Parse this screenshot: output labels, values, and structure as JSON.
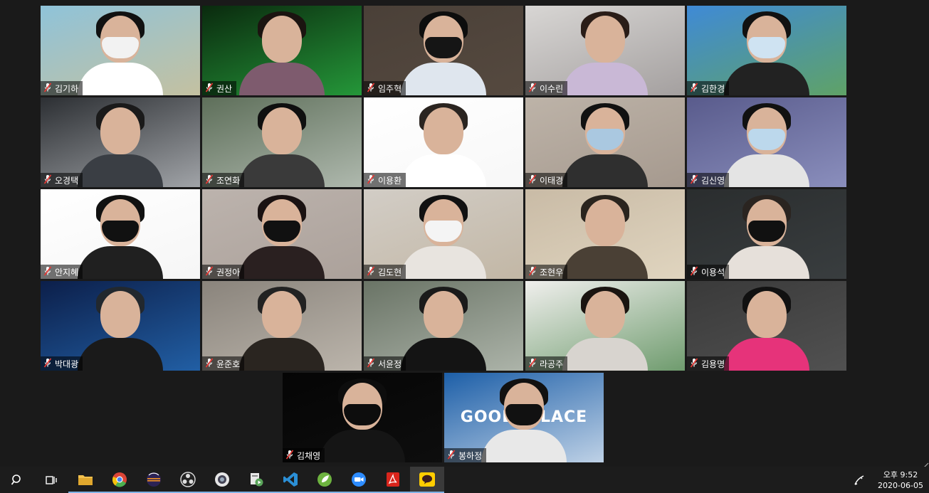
{
  "participants": [
    {
      "name": "김기하",
      "bg": "#8fc3d9",
      "accent": "#d9c08a",
      "shirt": "#ffffff",
      "mask": "#f2f2f2",
      "hair": "#111111"
    },
    {
      "name": "권산",
      "bg": "#0a2a0e",
      "accent": "#2fc24a",
      "shirt": "#7e5b6e",
      "mask": "",
      "hair": "#1b1410"
    },
    {
      "name": "임주혁",
      "bg": "#4a4038",
      "accent": "#5a4d42",
      "shirt": "#dfe6ee",
      "mask": "#151515",
      "hair": "#0d0d0d"
    },
    {
      "name": "이수린",
      "bg": "#d8d6d4",
      "accent": "#8f8a8a",
      "shirt": "#c9b8d6",
      "mask": "",
      "hair": "#2a1d18"
    },
    {
      "name": "김한경",
      "bg": "#3f8ad6",
      "accent": "#6cac3a",
      "shirt": "#222222",
      "mask": "#cfe3f2",
      "hair": "#111111"
    },
    {
      "name": "오경택",
      "bg": "#2c2f33",
      "accent": "#cfd2d6",
      "shirt": "#3a3e44",
      "mask": "",
      "hair": "#1a1a1a"
    },
    {
      "name": "조연화",
      "bg": "#5e6f5a",
      "accent": "#cfd6cf",
      "shirt": "#3a3a3a",
      "mask": "",
      "hair": "#0f0f0f"
    },
    {
      "name": "이용환",
      "bg": "#ffffff",
      "accent": "#f4f4f4",
      "shirt": "#ffffff",
      "mask": "",
      "hair": "#2a2420"
    },
    {
      "name": "이태경",
      "bg": "#bdb3a8",
      "accent": "#9c8f84",
      "shirt": "#2f2f2f",
      "mask": "#aac8e0",
      "hair": "#111111"
    },
    {
      "name": "김신영",
      "bg": "#595b8c",
      "accent": "#9ea3d0",
      "shirt": "#e4e4e4",
      "mask": "#bcd8ec",
      "hair": "#111111"
    },
    {
      "name": "안지혜",
      "bg": "#ffffff",
      "accent": "#f2f2f2",
      "shirt": "#202020",
      "mask": "#111111",
      "hair": "#111111"
    },
    {
      "name": "권정아",
      "bg": "#bcb3ad",
      "accent": "#a59a93",
      "shirt": "#2a2020",
      "mask": "#111111",
      "hair": "#1a1212"
    },
    {
      "name": "김도현",
      "bg": "#d2cdc6",
      "accent": "#bcae98",
      "shirt": "#e8e4df",
      "mask": "#f4f4f4",
      "hair": "#111111"
    },
    {
      "name": "조현우",
      "bg": "#c9bba6",
      "accent": "#e9dfc9",
      "shirt": "#4a4035",
      "mask": "",
      "hair": "#2a241e"
    },
    {
      "name": "이용석",
      "bg": "#2a2d2e",
      "accent": "#3f4446",
      "shirt": "#e6e0da",
      "mask": "#111111",
      "hair": "#2a2420"
    },
    {
      "name": "박대광",
      "bg": "#0c1f4a",
      "accent": "#2a78c8",
      "shirt": "#1a1a1a",
      "mask": "",
      "hair": "#22282e"
    },
    {
      "name": "윤준호",
      "bg": "#8a847c",
      "accent": "#cfc8be",
      "shirt": "#2a2520",
      "mask": "",
      "hair": "#222222"
    },
    {
      "name": "서윤정",
      "bg": "#6a7466",
      "accent": "#c7cdc4",
      "shirt": "#141414",
      "mask": "",
      "hair": "#1a1a1a"
    },
    {
      "name": "라공주",
      "bg": "#f0efed",
      "accent": "#3b7a3b",
      "shirt": "#d8d4cf",
      "mask": "",
      "hair": "#1a1410"
    },
    {
      "name": "김용명",
      "bg": "#3a3a3a",
      "accent": "#5a5a5a",
      "shirt": "#e6337a",
      "mask": "",
      "hair": "#111111"
    },
    {
      "name": "김채영",
      "bg": "#050505",
      "accent": "#111111",
      "shirt": "#151515",
      "mask": "#0d0d0d",
      "hair": "#0d0d0d"
    },
    {
      "name": "봉하정",
      "bg": "#1d5fa8",
      "accent": "#ffffff",
      "shirt": "#e8e8e8",
      "mask": "#111111",
      "hair": "#111111",
      "sign": "GOOD  PLACE"
    }
  ],
  "taskbar": {
    "apps": [
      {
        "icon": "search-icon",
        "color": "#ffffff"
      },
      {
        "icon": "task-view-icon",
        "color": "#ffffff"
      },
      {
        "icon": "file-explorer-icon",
        "color": "#f2c14e"
      },
      {
        "icon": "chrome-icon",
        "color": "#4caf50"
      },
      {
        "icon": "eclipse-icon",
        "color": "#2c2255"
      },
      {
        "icon": "obs-icon",
        "color": "#dddddd"
      },
      {
        "icon": "webcam-app-icon",
        "color": "#9ab"
      },
      {
        "icon": "media-app-icon",
        "color": "#5aa55a"
      },
      {
        "icon": "vscode-icon",
        "color": "#2b8fd6"
      },
      {
        "icon": "spring-icon",
        "color": "#6db33f"
      },
      {
        "icon": "zoom-icon",
        "color": "#2d8cff"
      },
      {
        "icon": "acrobat-icon",
        "color": "#d9251c"
      },
      {
        "icon": "kakaotalk-icon",
        "color": "#ffcd00"
      }
    ],
    "clock_time": "오후 9:52",
    "clock_date": "2020-06-05"
  }
}
